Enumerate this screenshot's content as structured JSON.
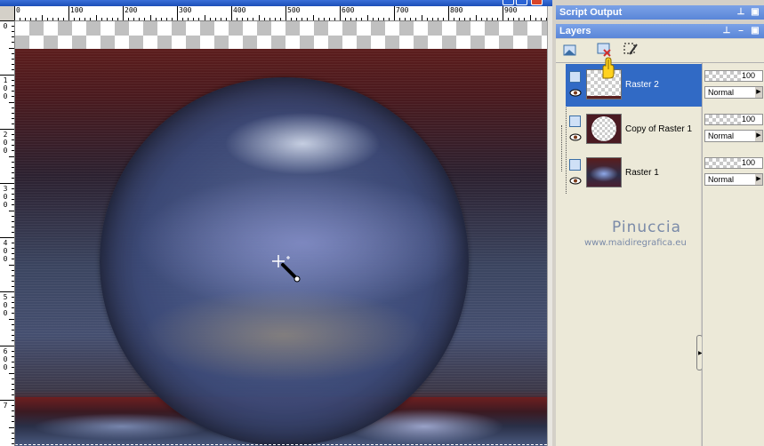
{
  "ruler": {
    "h_labels": [
      "0",
      "100",
      "200",
      "300",
      "400",
      "500",
      "600",
      "700",
      "800",
      "900"
    ],
    "v_labels": [
      "0",
      "1 0 0",
      "2 0 0",
      "3 0 0",
      "4 0 0",
      "5 0 0",
      "6 0 0",
      "7"
    ]
  },
  "script_output": {
    "title": "Script Output"
  },
  "layers_panel": {
    "title": "Layers",
    "layers": [
      {
        "name": "Raster 2",
        "selected": true
      },
      {
        "name": "Copy of Raster 1",
        "selected": false
      },
      {
        "name": "Raster 1",
        "selected": false
      }
    ],
    "props": [
      {
        "opacity": "100",
        "blend": "Normal"
      },
      {
        "opacity": "100",
        "blend": "Normal"
      },
      {
        "opacity": "100",
        "blend": "Normal"
      }
    ]
  },
  "watermark": {
    "name": "Pinuccia",
    "url": "www.maidiregrafica.eu"
  },
  "colors": {
    "selection": "#316ac5",
    "panel_title": "#5a86d8",
    "panel_bg": "#ece9d8"
  },
  "icons": [
    "pin-icon",
    "restore-icon",
    "minimize-icon",
    "new-layer-icon",
    "delete-layer-icon",
    "layer-properties-icon",
    "eye-icon",
    "pointing-hand-icon",
    "crosshair-cursor-icon"
  ]
}
